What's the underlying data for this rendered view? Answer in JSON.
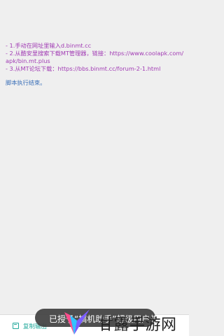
{
  "log": {
    "lines": [
      "- 1.手动在网址里输入d.binmt.cc",
      "- 2.从酷安里搜索下载MT管理器，链接：https://www.coolapk.com/apk/bin.mt.plus",
      "- 3.从MT论坛下载：https://bbs.binmt.cc/forum-2-1.html"
    ],
    "end_message": "脚本执行结束。"
  },
  "bottom_bar": {
    "copy_label": "复制输出"
  },
  "toast": {
    "text": "已授予“搞机助手”超级用户权限"
  },
  "watermark": {
    "text": "甘露手游网"
  },
  "colors": {
    "log": "#a13bb4",
    "end": "#3a6fb8",
    "accent": "#23a99b"
  }
}
